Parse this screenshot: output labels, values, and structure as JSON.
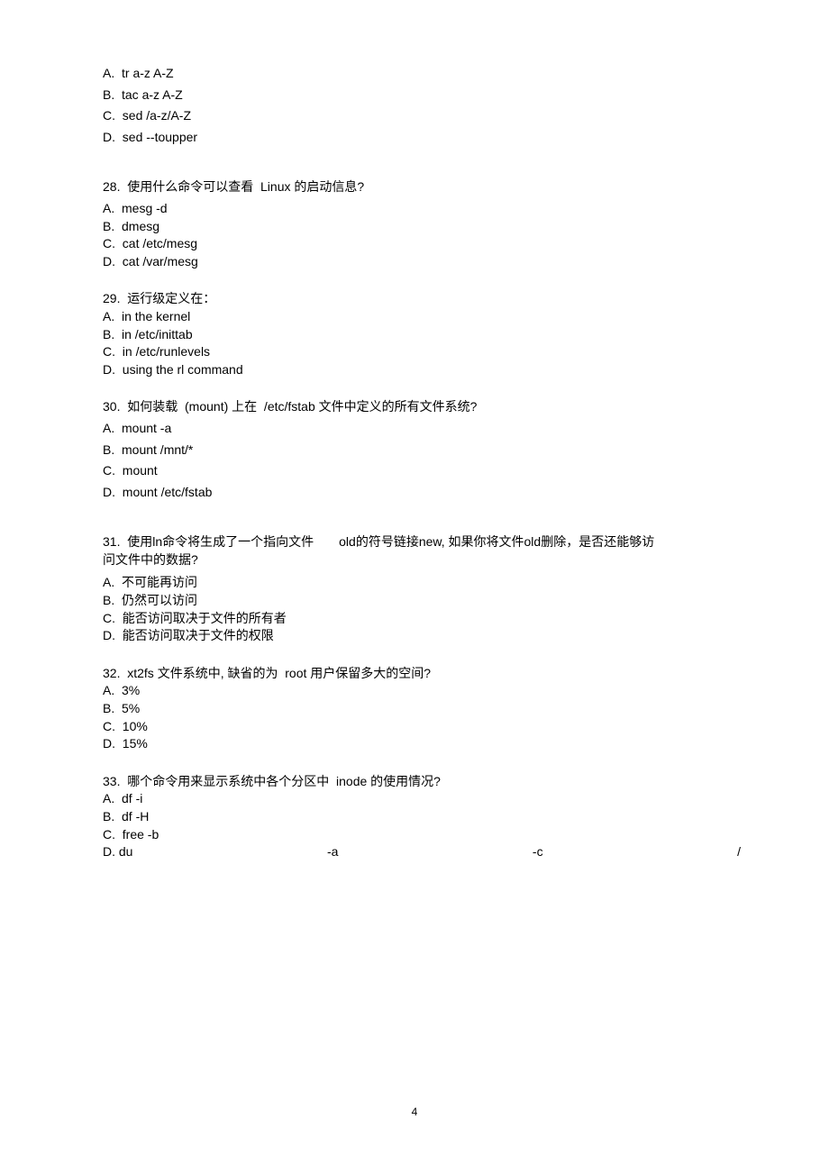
{
  "page_number": "4",
  "q27": {
    "a": "A.  tr a-z A-Z",
    "b": "B.  tac a-z A-Z",
    "c": "C.  sed /a-z/A-Z",
    "d": "D.  sed --toupper"
  },
  "q28": {
    "q": "28.  使用什么命令可以查看  Linux 的启动信息?",
    "a": "A.  mesg -d",
    "b": "B.  dmesg",
    "c": "C.  cat /etc/mesg",
    "d": "D.  cat /var/mesg"
  },
  "q29": {
    "q": "29.  运行级定义在：",
    "a": "A.  in the kernel",
    "b": "B.  in /etc/inittab",
    "c": "C.  in /etc/runlevels",
    "d": "D.  using the rl command"
  },
  "q30": {
    "q": "30.  如何装载  (mount) 上在  /etc/fstab 文件中定义的所有文件系统?",
    "a": "A.  mount -a",
    "b": "B.  mount /mnt/*",
    "c": "C.  mount",
    "d": "D.  mount /etc/fstab"
  },
  "q31": {
    "q_part1": "31.  使用ln命令将生成了一个指向文件",
    "q_part2": "old的符号链接new, 如果你将文件old删除，是否还能够访",
    "q_line2": "问文件中的数据?",
    "a": "A.  不可能再访问",
    "b": "B.  仍然可以访问",
    "c": "C.  能否访问取决于文件的所有者",
    "d": "D.  能否访问取决于文件的权限"
  },
  "q32": {
    "q": "32.  xt2fs 文件系统中, 缺省的为  root 用户保留多大的空间?",
    "a": "A.  3%",
    "b": "B.  5%",
    "c": "C.  10%",
    "d": "D.  15%"
  },
  "q33": {
    "q": "33.  哪个命令用来显示系统中各个分区中  inode 的使用情况?",
    "a": "A.  df -i",
    "b": "B.  df -H",
    "c": "C.  free -b",
    "d_label": "D.  du",
    "d_p1": "-a",
    "d_p2": "-c",
    "d_p3": "/"
  }
}
